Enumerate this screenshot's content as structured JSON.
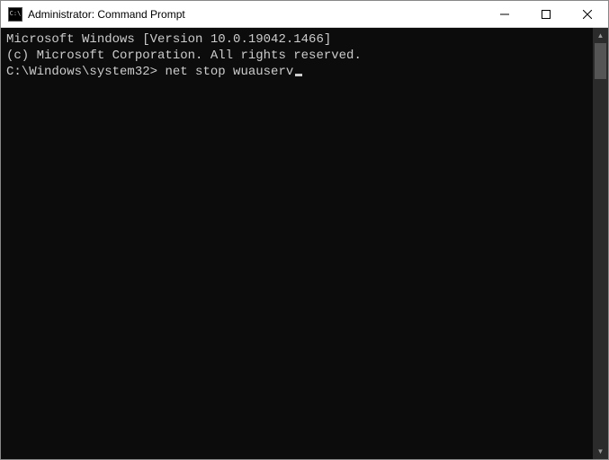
{
  "window": {
    "title": "Administrator: Command Prompt",
    "icon_label": "C:\\"
  },
  "terminal": {
    "line1": "Microsoft Windows [Version 10.0.19042.1466]",
    "line2": "(c) Microsoft Corporation. All rights reserved.",
    "blank": "",
    "prompt": "C:\\Windows\\system32>",
    "command": "net stop wuauserv"
  }
}
